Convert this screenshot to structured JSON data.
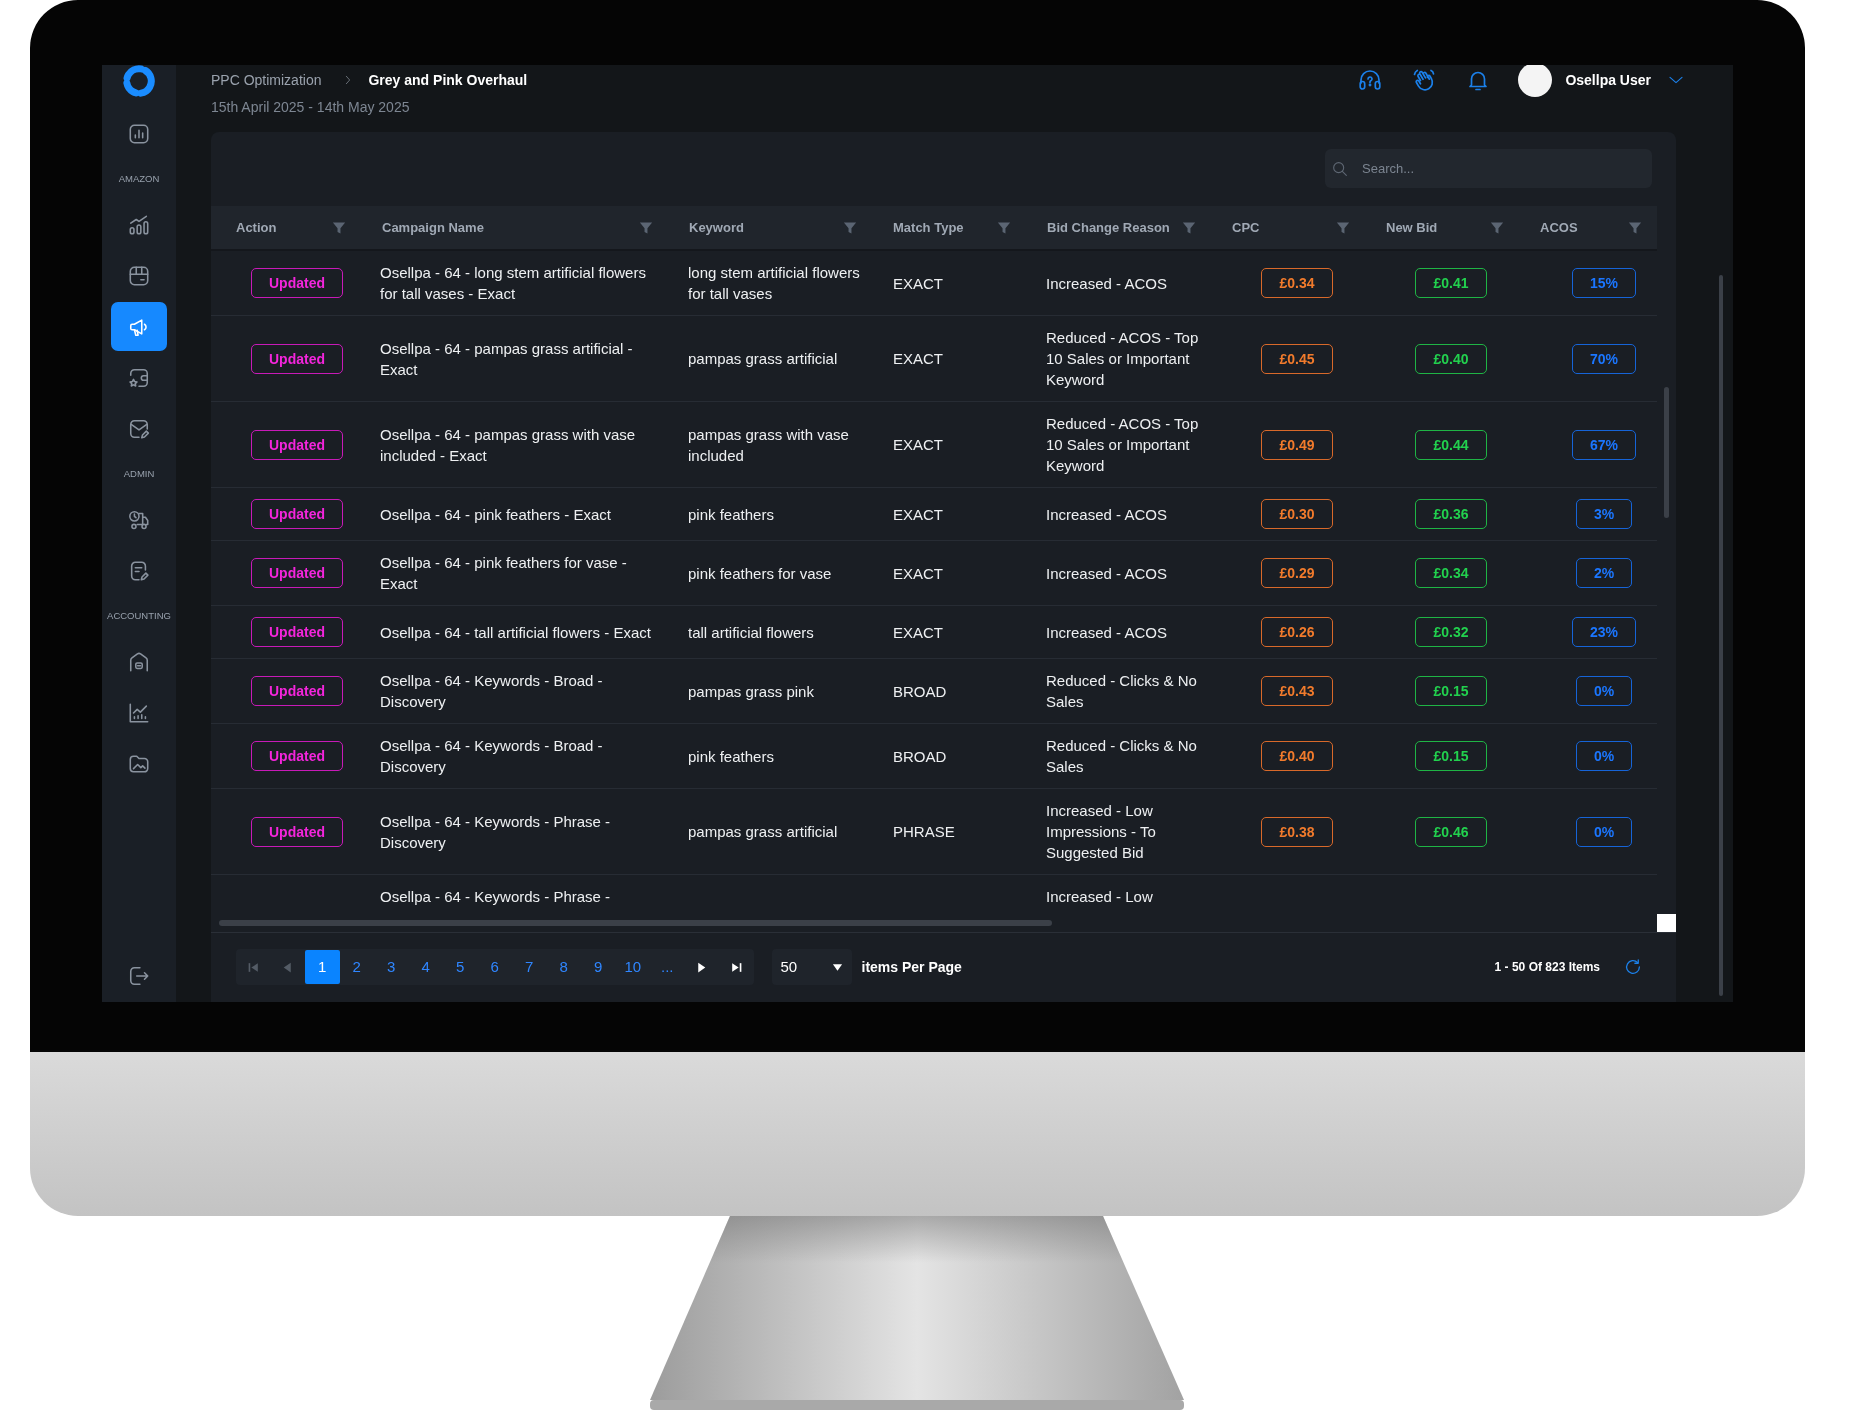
{
  "sidebar": {
    "groups": [
      {
        "items": [
          {
            "selected": false
          }
        ]
      },
      {
        "heading": "AMAZON",
        "items": [
          {
            "selected": false
          },
          {
            "selected": false
          },
          {
            "selected": true
          },
          {
            "selected": false
          },
          {
            "selected": false
          }
        ]
      },
      {
        "heading": "ADMIN",
        "items": [
          {
            "selected": false
          },
          {
            "selected": false
          }
        ]
      },
      {
        "heading": "ACCOUNTING",
        "items": [
          {
            "selected": false
          },
          {
            "selected": false
          },
          {
            "selected": false
          }
        ]
      }
    ]
  },
  "breadcrumb": [
    {
      "label": "PPC Optimization",
      "current": false
    },
    {
      "label": "Grey and Pink Overhaul",
      "current": true
    }
  ],
  "user": {
    "name": "Osellpa User"
  },
  "date_range": "15th April 2025 - 14th May 2025",
  "search": {
    "placeholder": "Search..."
  },
  "table": {
    "columns": [
      {
        "label": "Action"
      },
      {
        "label": "Campaign Name"
      },
      {
        "label": "Keyword"
      },
      {
        "label": "Match Type"
      },
      {
        "label": "Bid Change Reason"
      },
      {
        "label": "CPC"
      },
      {
        "label": "New Bid"
      },
      {
        "label": "ACOS"
      }
    ],
    "rows": [
      {
        "action": "Updated",
        "campaign": "Osellpa - 64 - long stem artificial flowers for tall vases - Exact",
        "keyword": "long stem artificial flowers for tall vases",
        "match_type": "EXACT",
        "reason": "Increased - ACOS",
        "cpc": "£0.34",
        "new_bid": "£0.41",
        "acos": "15%"
      },
      {
        "action": "Updated",
        "campaign": "Osellpa - 64 - pampas grass artificial - Exact",
        "keyword": "pampas grass artificial",
        "match_type": "EXACT",
        "reason": "Reduced - ACOS - Top 10 Sales or Important Keyword",
        "cpc": "£0.45",
        "new_bid": "£0.40",
        "acos": "70%"
      },
      {
        "action": "Updated",
        "campaign": "Osellpa - 64 - pampas grass with vase included - Exact",
        "keyword": "pampas grass with vase included",
        "match_type": "EXACT",
        "reason": "Reduced - ACOS - Top 10 Sales or Important Keyword",
        "cpc": "£0.49",
        "new_bid": "£0.44",
        "acos": "67%"
      },
      {
        "action": "Updated",
        "campaign": "Osellpa - 64 - pink feathers - Exact",
        "keyword": "pink feathers",
        "match_type": "EXACT",
        "reason": "Increased - ACOS",
        "cpc": "£0.30",
        "new_bid": "£0.36",
        "acos": "3%"
      },
      {
        "action": "Updated",
        "campaign": "Osellpa - 64 - pink feathers for vase - Exact",
        "keyword": "pink feathers for vase",
        "match_type": "EXACT",
        "reason": "Increased - ACOS",
        "cpc": "£0.29",
        "new_bid": "£0.34",
        "acos": "2%"
      },
      {
        "action": "Updated",
        "campaign": "Osellpa - 64 - tall artificial flowers - Exact",
        "keyword": "tall artificial flowers",
        "match_type": "EXACT",
        "reason": "Increased - ACOS",
        "cpc": "£0.26",
        "new_bid": "£0.32",
        "acos": "23%"
      },
      {
        "action": "Updated",
        "campaign": "Osellpa - 64 - Keywords - Broad - Discovery",
        "keyword": "pampas grass pink",
        "match_type": "BROAD",
        "reason": "Reduced - Clicks & No Sales",
        "cpc": "£0.43",
        "new_bid": "£0.15",
        "acos": "0%"
      },
      {
        "action": "Updated",
        "campaign": "Osellpa - 64 - Keywords - Broad - Discovery",
        "keyword": "pink feathers",
        "match_type": "BROAD",
        "reason": "Reduced - Clicks & No Sales",
        "cpc": "£0.40",
        "new_bid": "£0.15",
        "acos": "0%"
      },
      {
        "action": "Updated",
        "campaign": "Osellpa - 64 - Keywords - Phrase - Discovery",
        "keyword": "pampas grass artificial",
        "match_type": "PHRASE",
        "reason": "Increased - Low Impressions - To Suggested Bid",
        "cpc": "£0.38",
        "new_bid": "£0.46",
        "acos": "0%"
      },
      {
        "campaign": "Osellpa - 64 - Keywords - Phrase -",
        "reason": "Increased - Low"
      }
    ]
  },
  "pagination": {
    "buttons": [
      {
        "kind": "first",
        "disabled": true
      },
      {
        "kind": "previous",
        "disabled": true
      },
      {
        "kind": "next",
        "disabled": false
      },
      {
        "kind": "last",
        "disabled": false
      }
    ],
    "pages": [
      {
        "label": "1",
        "selected": true
      },
      {
        "label": "2",
        "selected": false
      },
      {
        "label": "3",
        "selected": false
      },
      {
        "label": "4",
        "selected": false
      },
      {
        "label": "5",
        "selected": false
      },
      {
        "label": "6",
        "selected": false
      },
      {
        "label": "7",
        "selected": false
      },
      {
        "label": "8",
        "selected": false
      },
      {
        "label": "9",
        "selected": false
      },
      {
        "label": "10",
        "selected": false
      },
      {
        "label": "...",
        "selected": false
      }
    ],
    "page_size": "50",
    "page_size_label": "items Per Page",
    "summary": "1 - 50 Of 823 Items"
  }
}
